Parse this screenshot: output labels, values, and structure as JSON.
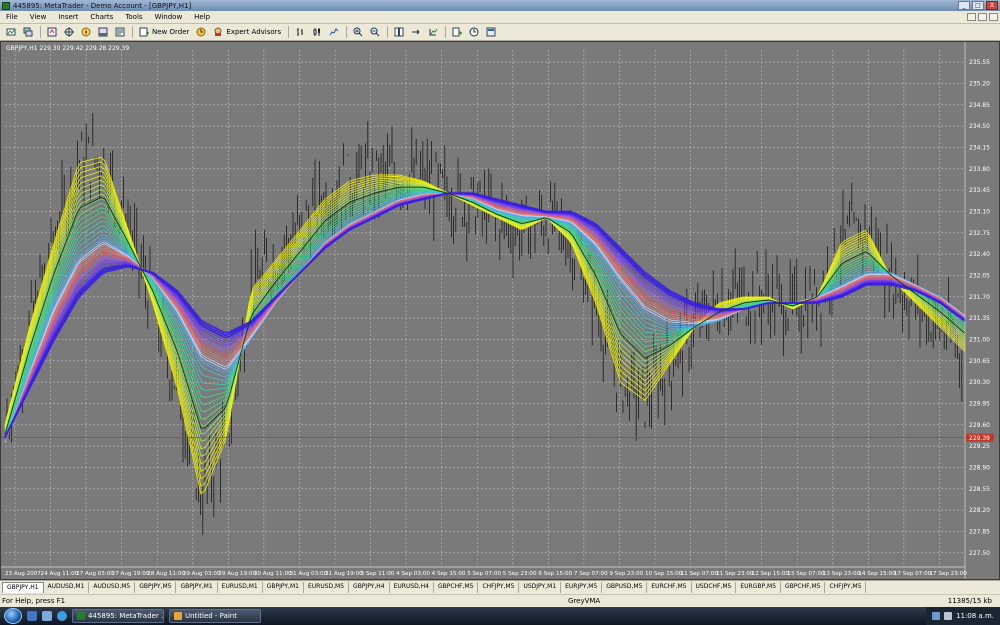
{
  "window": {
    "title": "445895: MetaTrader - Demo Account - [GBPJPY,H1]",
    "buttons": [
      "_",
      "□",
      "X"
    ]
  },
  "menu": {
    "items": [
      "File",
      "View",
      "Insert",
      "Charts",
      "Tools",
      "Window",
      "Help"
    ]
  },
  "toolbar": {
    "new_order_label": "New Order",
    "expert_advisors_label": "Expert Advisors"
  },
  "chart": {
    "symbol_info": "GBPJPY,H1  229.30 229.42 229.28 229.39",
    "current_price_label": "229.39",
    "colors": {
      "background": "#7a7a7a",
      "grid": "#bdbdbd",
      "candles": "#1a1a1a",
      "price_line": "#c0392b",
      "price_box": "#c0392b",
      "axis_text": "#ffffff"
    }
  },
  "chart_data": {
    "type": "line",
    "title": "",
    "symbol": "GBPJPY",
    "timeframe": "H1",
    "ylim": [
      227.35,
      235.75
    ],
    "y_ticks": [
      "235.55",
      "235.20",
      "234.85",
      "234.50",
      "234.15",
      "233.80",
      "233.45",
      "233.10",
      "232.75",
      "232.40",
      "232.05",
      "231.70",
      "231.35",
      "231.00",
      "230.65",
      "230.30",
      "229.95",
      "229.60",
      "229.25",
      "228.90",
      "228.55",
      "228.20",
      "227.85",
      "227.50"
    ],
    "x_ticks": [
      "23 Aug 2007",
      "24 Aug 11:00",
      "27 Aug 03:00",
      "27 Aug 19:00",
      "28 Aug 11:00",
      "29 Aug 03:00",
      "29 Aug 19:00",
      "30 Aug 11:00",
      "31 Aug 03:00",
      "31 Aug 19:00",
      "3 Sep 11:00",
      "4 Sep 03:00",
      "4 Sep 15:00",
      "5 Sep 07:00",
      "5 Sep 23:00",
      "6 Sep 15:00",
      "7 Sep 07:00",
      "9 Sep 23:00",
      "10 Sep 15:00",
      "11 Sep 07:00",
      "11 Sep 23:00",
      "12 Sep 15:00",
      "13 Sep 07:00",
      "13 Sep 23:00",
      "14 Sep 15:00",
      "17 Sep 07:00",
      "17 Sep 23:00"
    ],
    "current_price": 229.39,
    "series": [
      {
        "values": [
          229.6,
          231.2,
          232.6,
          233.9,
          234.0,
          232.8,
          231.6,
          230.2,
          228.4,
          229.4,
          231.8,
          232.3,
          232.8,
          233.3,
          233.6,
          233.7,
          233.7,
          233.6,
          233.4,
          233.2,
          233.0,
          232.8,
          233.0,
          232.6,
          231.6,
          230.3,
          230.0,
          230.6,
          231.2,
          231.6,
          231.7,
          231.7,
          231.5,
          231.7,
          232.6,
          232.8,
          232.0,
          231.6,
          231.2,
          230.8
        ]
      },
      {
        "values": [
          229.3,
          230.5,
          231.6,
          232.4,
          232.7,
          232.4,
          232.0,
          231.4,
          230.6,
          230.4,
          231.0,
          231.6,
          232.1,
          232.6,
          232.9,
          233.1,
          233.3,
          233.4,
          233.4,
          233.3,
          233.1,
          233.0,
          233.0,
          232.9,
          232.5,
          231.9,
          231.4,
          231.2,
          231.2,
          231.3,
          231.5,
          231.6,
          231.6,
          231.7,
          231.9,
          232.1,
          232.1,
          231.9,
          231.7,
          231.4
        ]
      },
      {
        "values": [
          229.4,
          230.2,
          231.0,
          231.7,
          232.1,
          232.2,
          232.1,
          231.8,
          231.3,
          231.1,
          231.3,
          231.7,
          232.1,
          232.5,
          232.8,
          233.0,
          233.2,
          233.3,
          233.4,
          233.4,
          233.3,
          233.2,
          233.1,
          233.1,
          232.9,
          232.5,
          232.1,
          231.8,
          231.6,
          231.5,
          231.5,
          231.6,
          231.6,
          231.6,
          231.7,
          231.9,
          231.9,
          231.8,
          231.6,
          231.3
        ]
      }
    ]
  },
  "sheet_tabs": [
    "GBPJPY,H1",
    "AUDUSD,M1",
    "AUDUSD,M5",
    "GBPJPY,M5",
    "GBPJPY,M1",
    "EURUSD,M1",
    "GBPJPY,M1",
    "EURUSD,M5",
    "GBPJPY,H4",
    "EURUSD,H4",
    "GBPCHF,M5",
    "CHFJPY,M5",
    "USDJPY,M1",
    "EURJPY,M5",
    "GBPUSD,M5",
    "EURCHF,M5",
    "USDCHF,M5",
    "EURGBP,M5",
    "GBPCHF,M5",
    "CHFJPY,M5"
  ],
  "status": {
    "help": "For Help, press F1",
    "profile": "GreyVMA",
    "traffic": "11385/15 kb"
  },
  "taskbar": {
    "tasks": [
      "445895: MetaTrader ...",
      "Untitled - Paint"
    ],
    "clock": "11:08 a.m."
  }
}
